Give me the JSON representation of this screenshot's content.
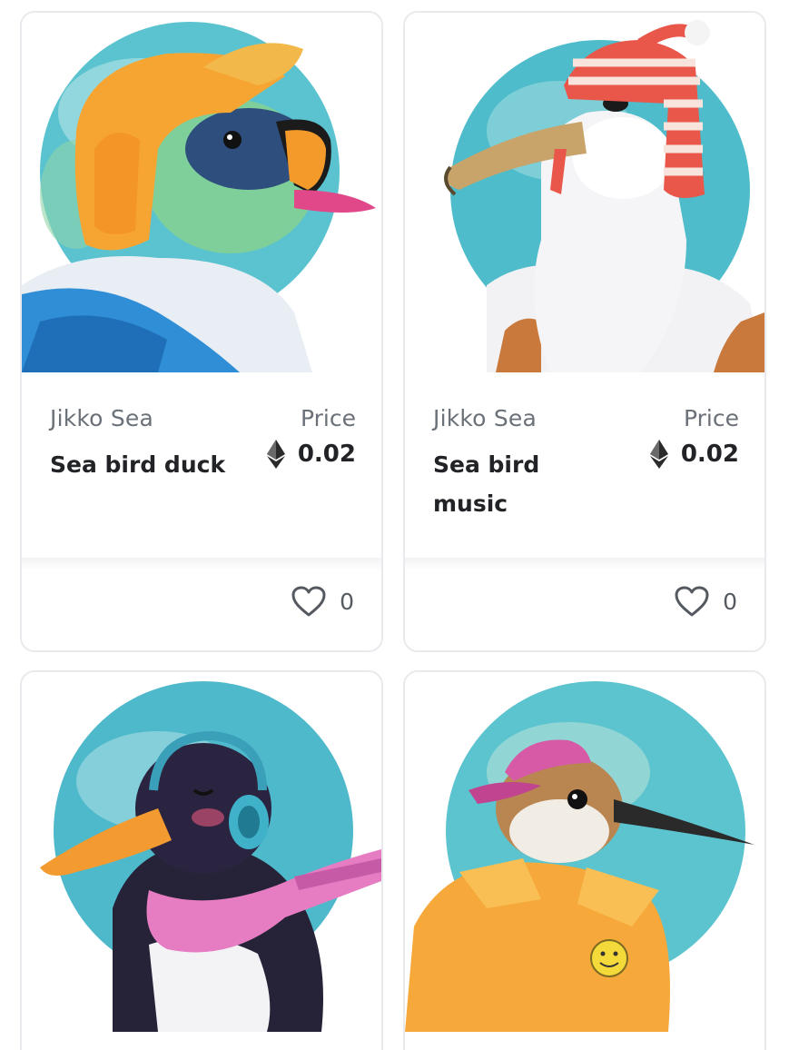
{
  "cards": [
    {
      "collection": "Jikko Sea",
      "name": "Sea bird duck",
      "price_label": "Price",
      "price": "0.02",
      "currency_icon": "ethereum-icon",
      "likes": "0",
      "like_icon": "heart-icon"
    },
    {
      "collection": "Jikko Sea",
      "name": "Sea bird music",
      "price_label": "Price",
      "price": "0.02",
      "currency_icon": "ethereum-icon",
      "likes": "0",
      "like_icon": "heart-icon"
    },
    {
      "artwork": "penguin-with-headphones"
    },
    {
      "artwork": "sandpiper-with-cap"
    }
  ],
  "colors": {
    "card_border": "#e9e9ee",
    "text_primary": "#222326",
    "text_secondary": "#6b7178",
    "art_backdrop": "#56c2cf"
  }
}
